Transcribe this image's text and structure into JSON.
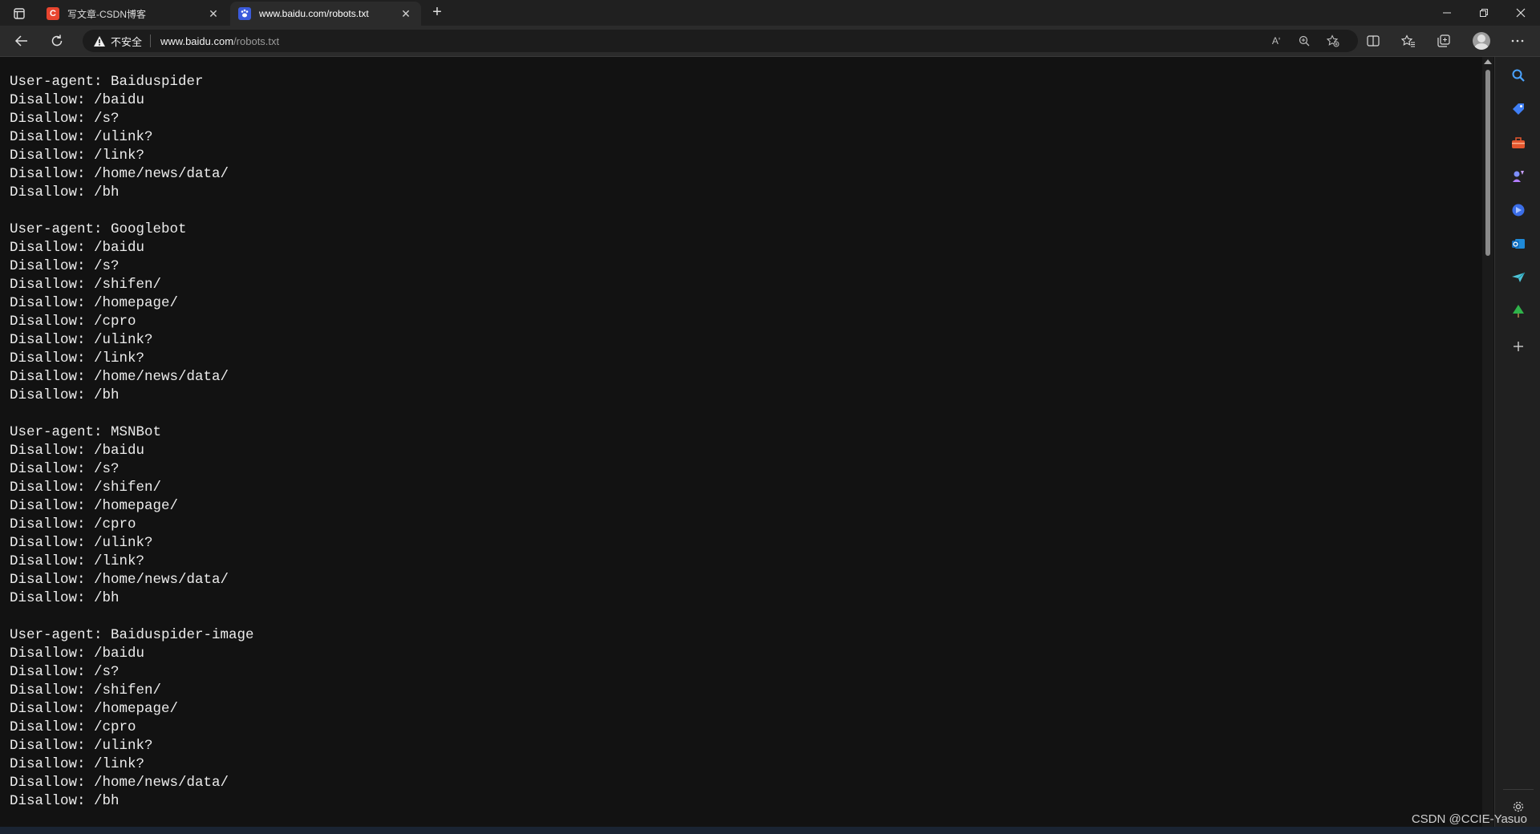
{
  "browser": {
    "tabs": [
      {
        "title": "写文章-CSDN博客",
        "favicon": "csdn-c-icon",
        "active": false
      },
      {
        "title": "www.baidu.com/robots.txt",
        "favicon": "baidu-paw-icon",
        "active": true
      }
    ],
    "security_label": "不安全",
    "url_host": "www.baidu.com",
    "url_path": "/robots.txt",
    "read_aloud_glyph": "Aʹ"
  },
  "page": {
    "robots_text": "User-agent: Baiduspider\nDisallow: /baidu\nDisallow: /s?\nDisallow: /ulink?\nDisallow: /link?\nDisallow: /home/news/data/\nDisallow: /bh\n\nUser-agent: Googlebot\nDisallow: /baidu\nDisallow: /s?\nDisallow: /shifen/\nDisallow: /homepage/\nDisallow: /cpro\nDisallow: /ulink?\nDisallow: /link?\nDisallow: /home/news/data/\nDisallow: /bh\n\nUser-agent: MSNBot\nDisallow: /baidu\nDisallow: /s?\nDisallow: /shifen/\nDisallow: /homepage/\nDisallow: /cpro\nDisallow: /ulink?\nDisallow: /link?\nDisallow: /home/news/data/\nDisallow: /bh\n\nUser-agent: Baiduspider-image\nDisallow: /baidu\nDisallow: /s?\nDisallow: /shifen/\nDisallow: /homepage/\nDisallow: /cpro\nDisallow: /ulink?\nDisallow: /link?\nDisallow: /home/news/data/\nDisallow: /bh"
  },
  "watermark": "CSDN @CCIE-Yasuo",
  "colors": {
    "background": "#121212",
    "tab_strip": "#202020",
    "toolbar": "#2b2b2b",
    "csdn_red": "#e8452f",
    "baidu_blue": "#3b5bdb"
  },
  "sidebar_icons": [
    "search-icon",
    "tag-icon",
    "toolbox-icon",
    "games-icon",
    "office-icon",
    "outlook-icon",
    "send-icon",
    "tree-icon",
    "add-icon",
    "settings-icon"
  ]
}
